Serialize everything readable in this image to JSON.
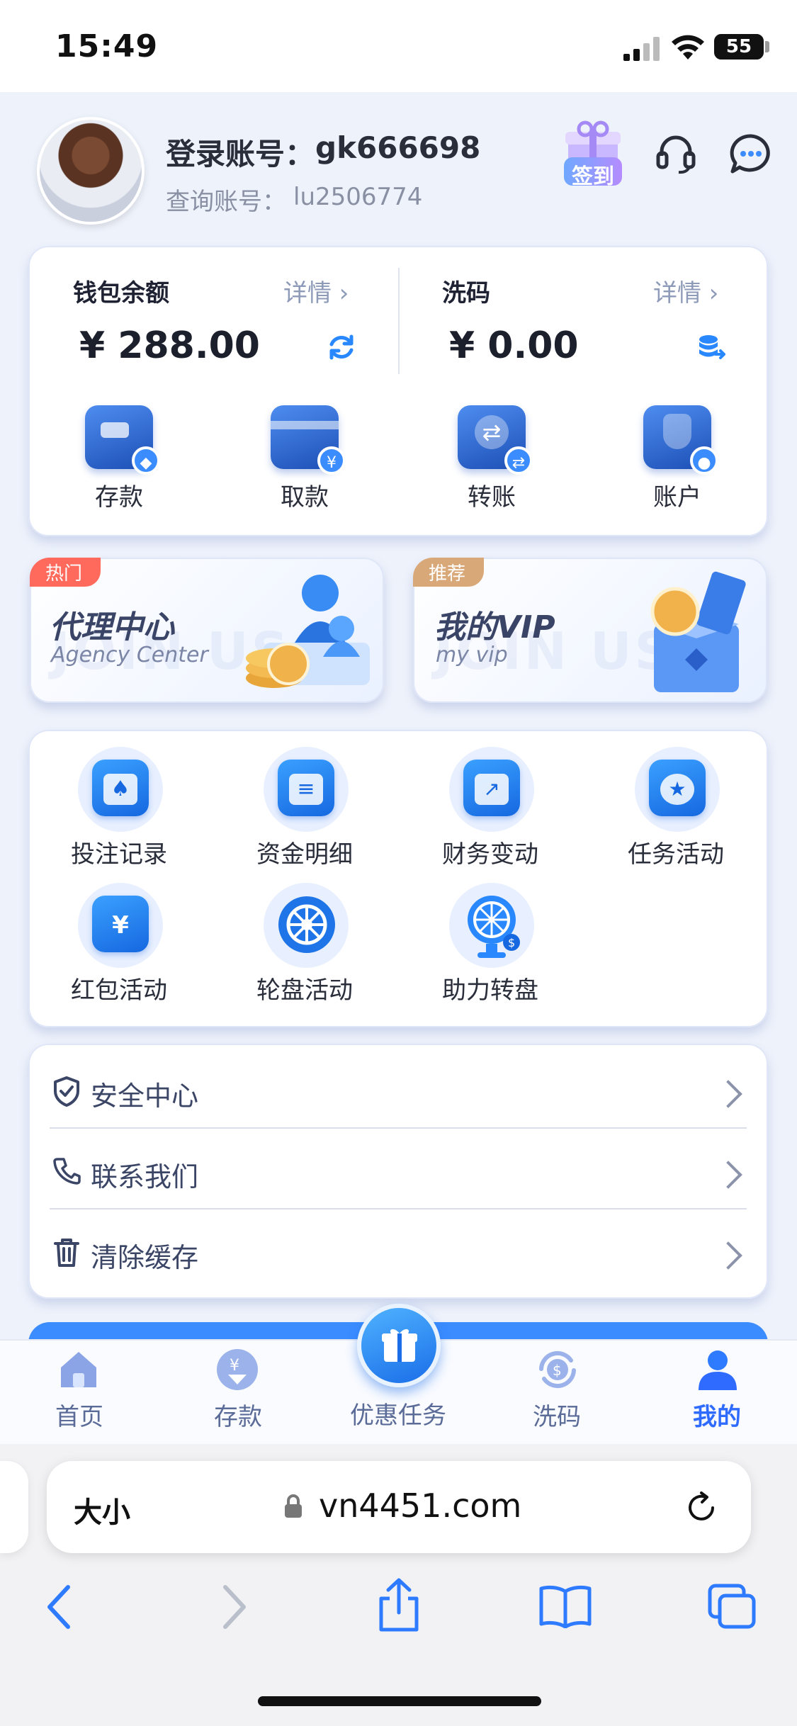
{
  "status_bar": {
    "time": "15:49",
    "battery": "55"
  },
  "profile": {
    "login_label": "登录账号：",
    "login_id": "gk666698",
    "query_label": "查询账号：",
    "query_id": "lu2506774",
    "signin_label": "签到"
  },
  "wallet": {
    "balance_label": "钱包余额",
    "balance_detail": "详情 ›",
    "balance_amount": "¥ 288.00",
    "wash_label": "洗码",
    "wash_detail": "详情 ›",
    "wash_amount": "¥ 0.00",
    "actions": [
      {
        "label": "存款",
        "icon": "wallet-icon"
      },
      {
        "label": "取款",
        "icon": "card-icon"
      },
      {
        "label": "转账",
        "icon": "transfer-icon"
      },
      {
        "label": "账户",
        "icon": "account-icon"
      }
    ]
  },
  "promos": [
    {
      "tag": "热门",
      "title": "代理中心",
      "subtitle": "Agency Center",
      "watermark": "JOIN US",
      "tag_color": "#ff6a5c"
    },
    {
      "tag": "推荐",
      "title": "我的VIP",
      "subtitle": "my vip",
      "watermark": "JOIN US",
      "tag_color": "#d9a878"
    }
  ],
  "features": [
    {
      "label": "投注记录",
      "icon": "bet-record-icon"
    },
    {
      "label": "资金明细",
      "icon": "fund-detail-icon"
    },
    {
      "label": "财务变动",
      "icon": "finance-change-icon"
    },
    {
      "label": "任务活动",
      "icon": "task-icon"
    },
    {
      "label": "红包活动",
      "icon": "red-envelope-icon"
    },
    {
      "label": "轮盘活动",
      "icon": "roulette-icon"
    },
    {
      "label": "助力转盘",
      "icon": "wheel-icon"
    }
  ],
  "menu": [
    {
      "label": "安全中心",
      "icon": "shield-icon"
    },
    {
      "label": "联系我们",
      "icon": "phone-icon"
    },
    {
      "label": "清除缓存",
      "icon": "trash-icon"
    }
  ],
  "tabbar": [
    {
      "label": "首页",
      "icon": "home-icon",
      "active": false
    },
    {
      "label": "存款",
      "icon": "deposit-icon",
      "active": false
    },
    {
      "label": "优惠任务",
      "icon": "gift-icon",
      "active": false
    },
    {
      "label": "洗码",
      "icon": "wash-icon",
      "active": false
    },
    {
      "label": "我的",
      "icon": "user-icon",
      "active": true
    }
  ],
  "browser": {
    "text_size": "大小",
    "url": "vn4451.com"
  },
  "colors": {
    "accent": "#3b8cff",
    "active_tab": "#2f6bff",
    "tab_text": "#5b6b98"
  }
}
